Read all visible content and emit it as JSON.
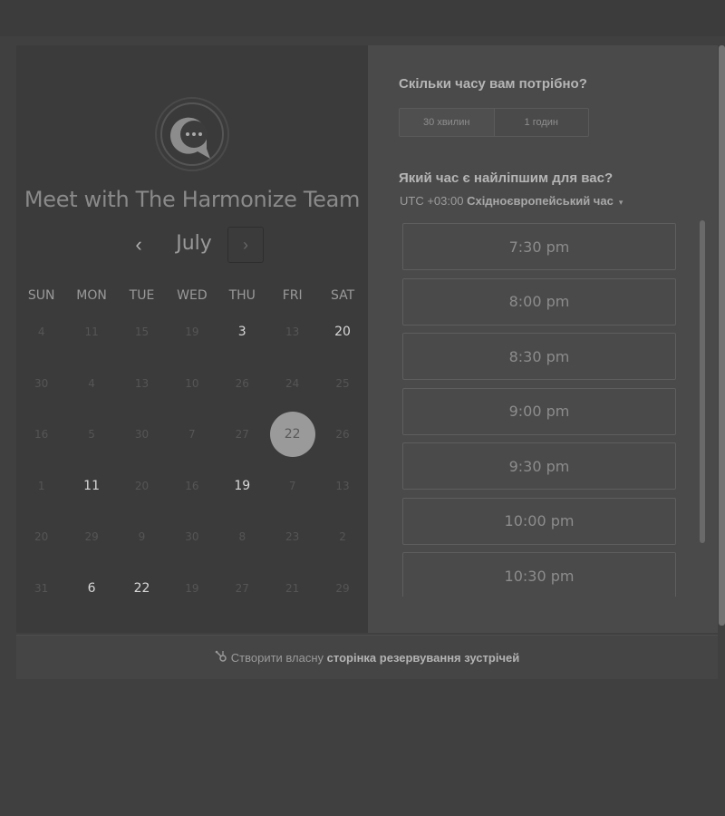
{
  "calendar": {
    "title": "Meet with The Harmonize Team",
    "month": "July",
    "prev_icon": "chevron-left-icon",
    "next_icon": "chevron-right-icon",
    "weekdays": [
      "SUN",
      "MON",
      "TUE",
      "WED",
      "THU",
      "FRI",
      "SAT"
    ],
    "weeks": [
      [
        {
          "d": "4",
          "a": false
        },
        {
          "d": "11",
          "a": false
        },
        {
          "d": "15",
          "a": false
        },
        {
          "d": "19",
          "a": false
        },
        {
          "d": "3",
          "a": true
        },
        {
          "d": "13",
          "a": false
        },
        {
          "d": "20",
          "a": true
        }
      ],
      [
        {
          "d": "30",
          "a": false
        },
        {
          "d": "4",
          "a": false
        },
        {
          "d": "13",
          "a": false
        },
        {
          "d": "10",
          "a": false
        },
        {
          "d": "26",
          "a": false
        },
        {
          "d": "24",
          "a": false
        },
        {
          "d": "25",
          "a": false
        }
      ],
      [
        {
          "d": "16",
          "a": false
        },
        {
          "d": "5",
          "a": false
        },
        {
          "d": "30",
          "a": false
        },
        {
          "d": "7",
          "a": false
        },
        {
          "d": "27",
          "a": false
        },
        {
          "d": "22",
          "a": true,
          "selected": true
        },
        {
          "d": "26",
          "a": false
        }
      ],
      [
        {
          "d": "1",
          "a": false
        },
        {
          "d": "11",
          "a": true
        },
        {
          "d": "20",
          "a": false
        },
        {
          "d": "16",
          "a": false
        },
        {
          "d": "19",
          "a": true
        },
        {
          "d": "7",
          "a": false
        },
        {
          "d": "13",
          "a": false
        }
      ],
      [
        {
          "d": "20",
          "a": false
        },
        {
          "d": "29",
          "a": false
        },
        {
          "d": "9",
          "a": false
        },
        {
          "d": "30",
          "a": false
        },
        {
          "d": "8",
          "a": false
        },
        {
          "d": "23",
          "a": false
        },
        {
          "d": "2",
          "a": false
        }
      ],
      [
        {
          "d": "31",
          "a": false
        },
        {
          "d": "6",
          "a": true
        },
        {
          "d": "22",
          "a": true
        },
        {
          "d": "19",
          "a": false
        },
        {
          "d": "27",
          "a": false
        },
        {
          "d": "21",
          "a": false
        },
        {
          "d": "29",
          "a": false
        }
      ]
    ]
  },
  "booking": {
    "duration_question": "Скільки часу вам потрібно?",
    "durations": [
      "30 хвилин",
      "1 годин"
    ],
    "time_question": "Який час є найліпшим для вас?",
    "timezone_offset": "UTC +03:00",
    "timezone_name": "Східноєвропейський час",
    "slots": [
      "7:30 pm",
      "8:00 pm",
      "8:30 pm",
      "9:00 pm",
      "9:30 pm",
      "10:00 pm",
      "10:30 pm"
    ]
  },
  "footer": {
    "prefix": "Створити власну",
    "link": "сторінка резервування зустрічей",
    "icon": "hubspot-sprocket-icon"
  },
  "colors": {
    "selected_day": "#9a9a9a",
    "panel": "#3b3b3b"
  }
}
